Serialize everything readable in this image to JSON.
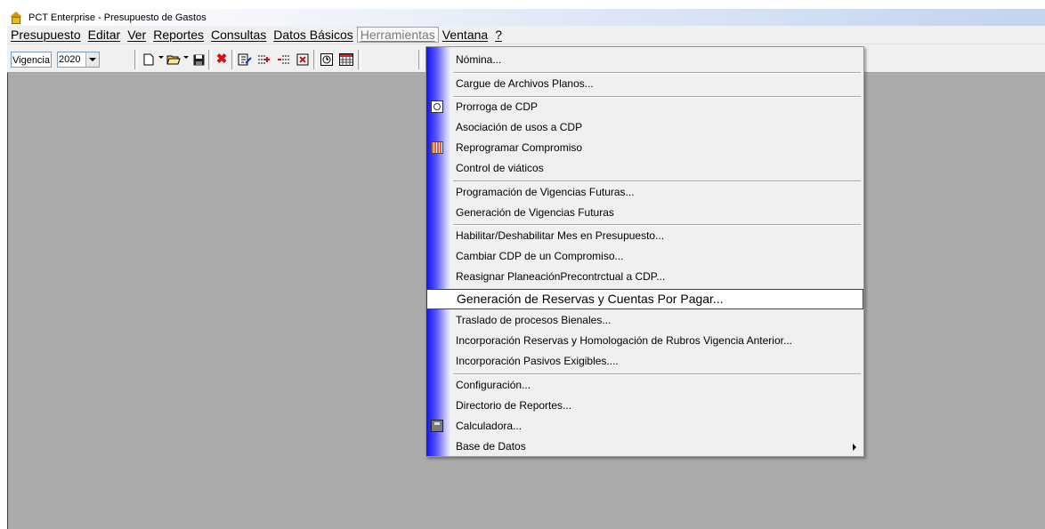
{
  "window": {
    "title": "PCT Enterprise - Presupuesto de Gastos"
  },
  "menubar": {
    "items": [
      "Presupuesto",
      "Editar",
      "Ver",
      "Reportes",
      "Consultas",
      "Datos Básicos",
      "Herramientas",
      "Ventana",
      "?"
    ],
    "active": "Herramientas"
  },
  "toolbar": {
    "vigencia_label": "Vigencia",
    "vigencia_value": "2020",
    "icons": [
      "new-document-icon",
      "open-folder-icon",
      "save-icon",
      "delete-icon",
      "edit-icon",
      "insert-rows-icon",
      "remove-rows-icon",
      "clear-icon",
      "clock-icon",
      "calendar-icon"
    ]
  },
  "herramientas_menu": {
    "items": [
      "Nómina...",
      "Cargue de Archivos Planos...",
      "Prorroga de CDP",
      "Asociación de usos a CDP",
      "Reprogramar Compromiso",
      "Control de viáticos",
      "Programación de Vigencias Futuras...",
      "Generación de Vigencias Futuras",
      "Habilitar/Deshabilitar Mes en Presupuesto...",
      "Cambiar CDP de un Compromiso...",
      "Reasignar PlaneaciónPrecontrctual a CDP...",
      "Generación de Reservas y Cuentas Por Pagar...",
      "Traslado de procesos Bienales...",
      "Incorporación Reservas y Homologación de Rubros Vigencia Anterior...",
      "Incorporación Pasivos Exigibles....",
      "Configuración...",
      "Directorio de Reportes...",
      "Calculadora...",
      "Base de Datos"
    ],
    "highlighted": "Generación de Reservas y Cuentas Por Pagar...",
    "item_icons": {
      "Prorroga de CDP": "clock-icon",
      "Reprogramar Compromiso": "calendar-icon",
      "Calculadora...": "calculator-icon"
    },
    "submenu": "Base de Datos"
  },
  "colors": {
    "gutter_dark": "#1212e6",
    "highlight_border": "#2e2ec0",
    "client_area": "#ababab"
  }
}
